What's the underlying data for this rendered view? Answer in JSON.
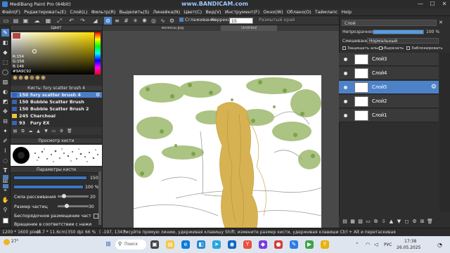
{
  "window": {
    "title": "MediBang Paint Pro (64bit)",
    "watermark": "www.BANDICAM.com",
    "controls": [
      "—",
      "☐",
      "✕"
    ]
  },
  "menu": [
    "Файл(F)",
    "Редактировать(E)",
    "Слой(L)",
    "Фильтр(R)",
    "Выделить(S)",
    "Линейка(N)",
    "Цвет(C)",
    "Вид(V)",
    "Инструмент(F)",
    "Окно(W)",
    "Облако(O)",
    "Таймлапс",
    "Help"
  ],
  "toolbar": {
    "antialias_label": "Сглаживание",
    "correction_label": "Коррекция",
    "correction_value": "15",
    "edge_label": "Размытый край"
  },
  "color_panel": {
    "title": "Цвет",
    "r": "R:154",
    "g": "G:156",
    "b": "B:146",
    "hex": "#9A9C92"
  },
  "brush_panel": {
    "title": "Кисть: fury scatter brush 4",
    "items": [
      {
        "size": "150",
        "name": "fury scatter brush 4",
        "selected": true,
        "color": "#3b62b3"
      },
      {
        "size": "150",
        "name": "Bubble Scatter Brush",
        "selected": false,
        "color": "#3b62b3"
      },
      {
        "size": "150",
        "name": "Bubble Scatter Brush 2",
        "selected": false,
        "color": "#3b62b3"
      },
      {
        "size": "245",
        "name": "Charchoal",
        "selected": false,
        "color": "#e8c53a"
      },
      {
        "size": "93",
        "name": "Fury EX",
        "selected": false,
        "color": "#3b62b3"
      }
    ]
  },
  "brush_preview": {
    "title": "Просмотр кисти"
  },
  "brush_params": {
    "title": "Параметры кисти",
    "size_value": "150",
    "opacity_value": "100 %",
    "opacity_fraction": 1.0,
    "scatter_label": "Сила рассеивания",
    "scatter_value": "20",
    "scatter_fraction": 0.2,
    "particle_label": "Размер частиц",
    "particle_value": "30",
    "particle_fraction": 0.3,
    "random_label": "Беспорядочное размещение частиц",
    "sync_label": "Вращение в соответствии с нажим"
  },
  "canvas_tabs": [
    "волосы.jpg",
    "Untitled"
  ],
  "layers_panel": {
    "name_field": "Слой",
    "opacity_label": "Непрозрачность",
    "opacity_value": "100 %",
    "blend_label": "Смешивание",
    "blend_value": "Нормальный",
    "protect_alpha": "Защищать альфа",
    "clip": "Вырезать",
    "lock": "Заблокировать",
    "layers": [
      {
        "name": "Слой3",
        "active": false
      },
      {
        "name": "Слой4",
        "active": false
      },
      {
        "name": "Слой5",
        "active": true
      },
      {
        "name": "Слой2",
        "active": false
      },
      {
        "name": "Слой1",
        "active": false
      }
    ]
  },
  "status": {
    "dimensions": "1200 * 1600 pixel",
    "size_cm": "(8.7 * 11.6cm)",
    "dpi": "350 dpi",
    "zoom": "66 %",
    "coords": "( -197, 134 )",
    "hint": "Рисуйте прямую линию, удерживая клавишу Shift; измените размер кисти, удерживая клавиши Ctrl + Alt и перетаскивая"
  },
  "taskbar": {
    "weather": "27°",
    "search_placeholder": "Поиск",
    "lang": "РУС",
    "time": "17:38",
    "date": "26.05.2025"
  }
}
